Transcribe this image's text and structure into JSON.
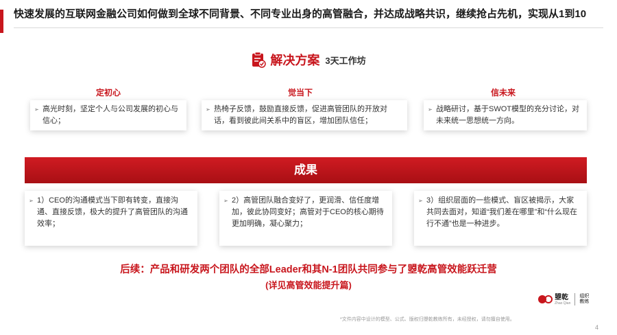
{
  "header": {
    "title": "快速发展的互联网金融公司如何做到全球不同背景、不同专业出身的高管融合，并达成战略共识，继续抢占先机，实现从1到10"
  },
  "solution": {
    "title": "解决方案",
    "subtitle": "3天工作坊",
    "icon": "checklist-icon",
    "columns": [
      {
        "heading": "定初心",
        "text": "高光时刻，坚定个人与公司发展的初心与信心；"
      },
      {
        "heading": "觉当下",
        "text": "热椅子反馈，鼓励直接反馈，促进高管团队的开放对话，看到彼此间关系中的盲区，增加团队信任；"
      },
      {
        "heading": "信未来",
        "text": "战略研讨，基于SWOT模型的充分讨论，对未来统一思想统一方向。"
      }
    ]
  },
  "results": {
    "title": "成果",
    "items": [
      {
        "text": "1）CEO的沟通模式当下即有转变，直接沟通、直接反馈，极大的提升了高管团队的沟通效率；"
      },
      {
        "text": "2）高管团队融合变好了，更润滑、信任度增加，彼此协同变好；高管对于CEO的核心期待更加明确，凝心聚力；"
      },
      {
        "text": "3）组织层面的一些模式、盲区被揭示，大家共同去面对，知道“我们差在哪里”和“什么现在行不通”也是一种进步。"
      }
    ]
  },
  "followup": {
    "line1": "后续：产品和研发两个团队的全部Leader和其N-1团队共同参与了曌乾高管效能跃迁营",
    "line2": "(详见高管效能提升篇)"
  },
  "logo": {
    "name": "曌乾",
    "pinyin": "Zhao Qian",
    "tagline": "组织教练"
  },
  "footer": {
    "note": "*文件内容中设计的模型、公式、版权归曌乾教练所有，未经授权，请勿擅自使用。",
    "page": "4"
  },
  "colors": {
    "accent": "#c8161d",
    "text": "#333333"
  }
}
